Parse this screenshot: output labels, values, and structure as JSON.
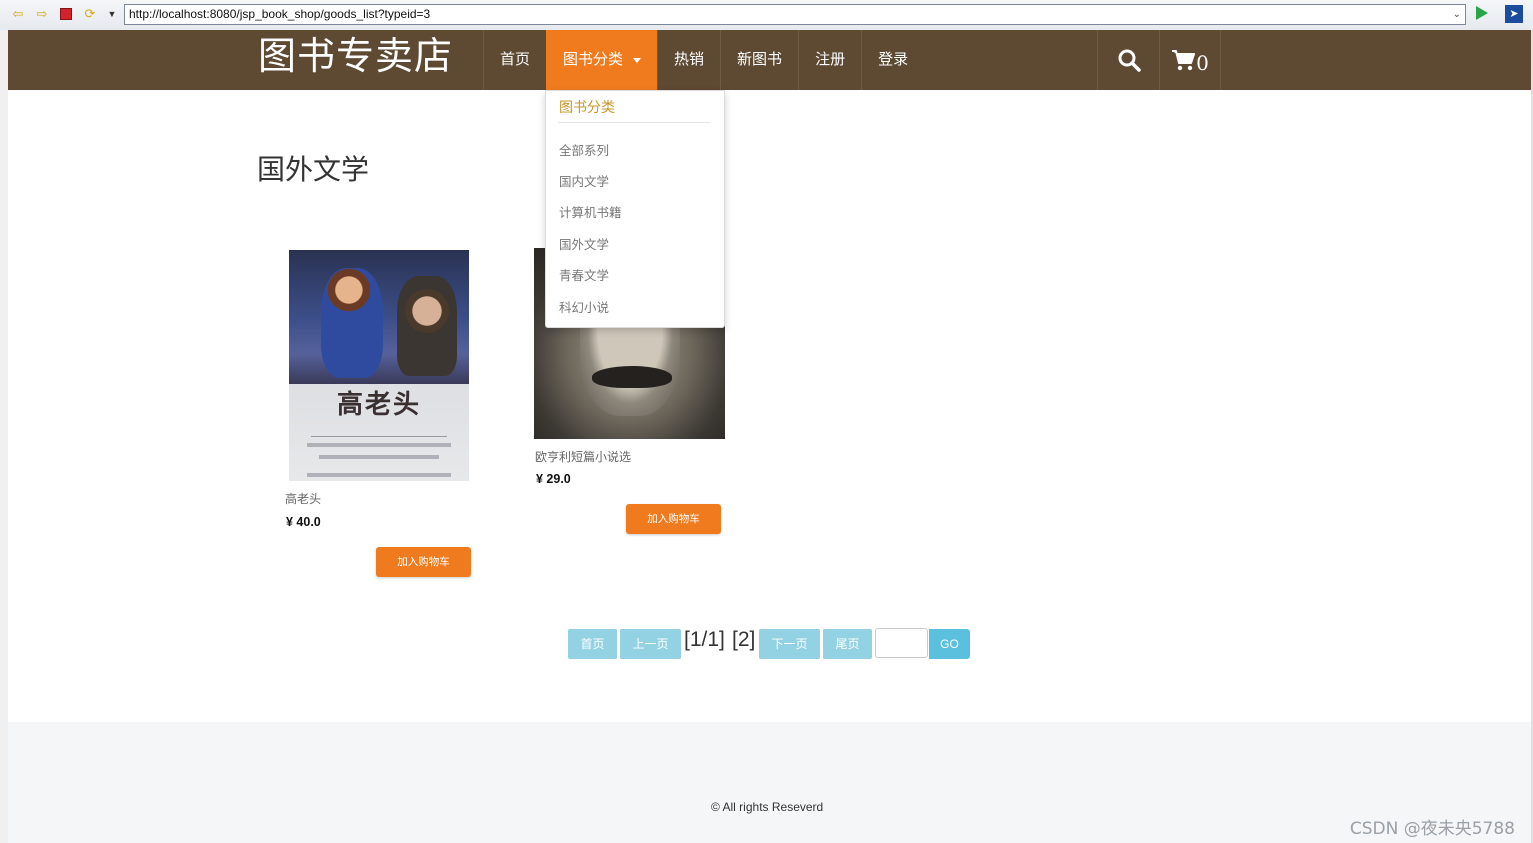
{
  "browser": {
    "url": "http://localhost:8080/jsp_book_shop/goods_list?typeid=3"
  },
  "nav": {
    "brand": "图书专卖店",
    "items": [
      {
        "label": "首页"
      },
      {
        "label": "图书分类",
        "active": true
      },
      {
        "label": "热销"
      },
      {
        "label": "新图书"
      },
      {
        "label": "注册"
      },
      {
        "label": "登录"
      }
    ],
    "cart_count": "0"
  },
  "dropdown": {
    "header": "图书分类",
    "items": [
      "全部系列",
      "国内文学",
      "计算机书籍",
      "国外文学",
      "青春文学",
      "科幻小说"
    ]
  },
  "main": {
    "category_title": "国外文学",
    "books": [
      {
        "name": "高老头",
        "price": "¥ 40.0",
        "cover_title": "高老头",
        "button": "加入购物车"
      },
      {
        "name": "欧亨利短篇小说选",
        "price": "¥ 29.0",
        "button": "加入购物车"
      }
    ]
  },
  "pagination": {
    "first": "首页",
    "prev": "上一页",
    "status": "[1/1]",
    "page": "[2]",
    "next": "下一页",
    "last": "尾页",
    "go": "GO"
  },
  "footer": {
    "copyright": "© All rights Reseverd",
    "watermark": "CSDN @夜未央5788"
  },
  "colors": {
    "nav_bg": "#5e4a33",
    "accent": "#f07b1f",
    "pager": "#93d2e3",
    "go": "#5bc0de"
  }
}
